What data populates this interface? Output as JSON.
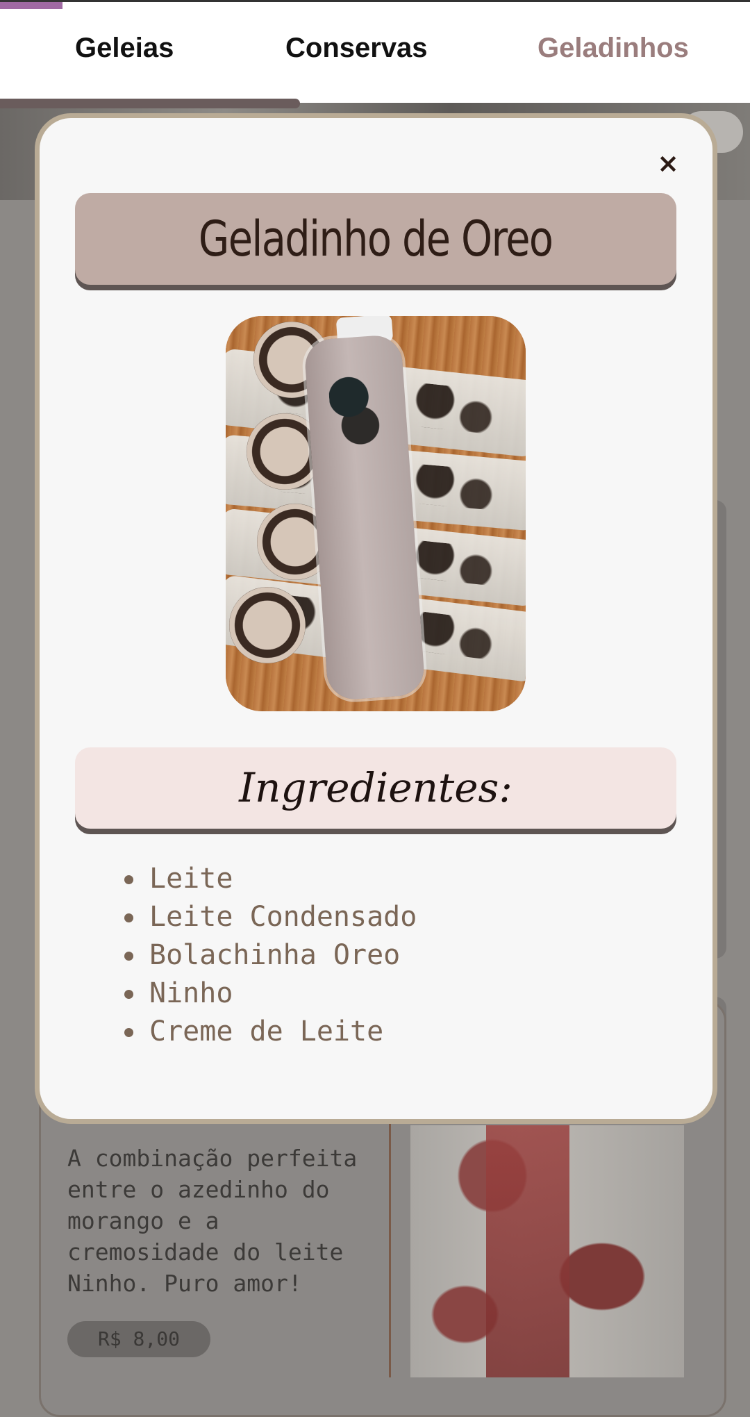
{
  "tabs": [
    {
      "label": "Geleias",
      "active": false
    },
    {
      "label": "Conservas",
      "active": false
    },
    {
      "label": "Geladinhos",
      "active": true
    }
  ],
  "background_card": {
    "description": "A combinação perfeita entre o azedinho do morango e a cremosidade do leite Ninho. Puro amor!",
    "price": "R$ 8,00"
  },
  "modal": {
    "close_label": "×",
    "title": "Geladinho de Oreo",
    "ingredients_heading": "Ingredientes:",
    "ingredients": [
      "Leite",
      "Leite Condensado",
      "Bolachinha Oreo",
      "Ninho",
      "Creme de Leite"
    ]
  },
  "colors": {
    "accent": "#9a7d7d",
    "title_band": "#bfaba4",
    "ingredients_band": "#f3e5e3",
    "modal_border": "#b9ab95",
    "ingredient_text": "#7a6656"
  }
}
